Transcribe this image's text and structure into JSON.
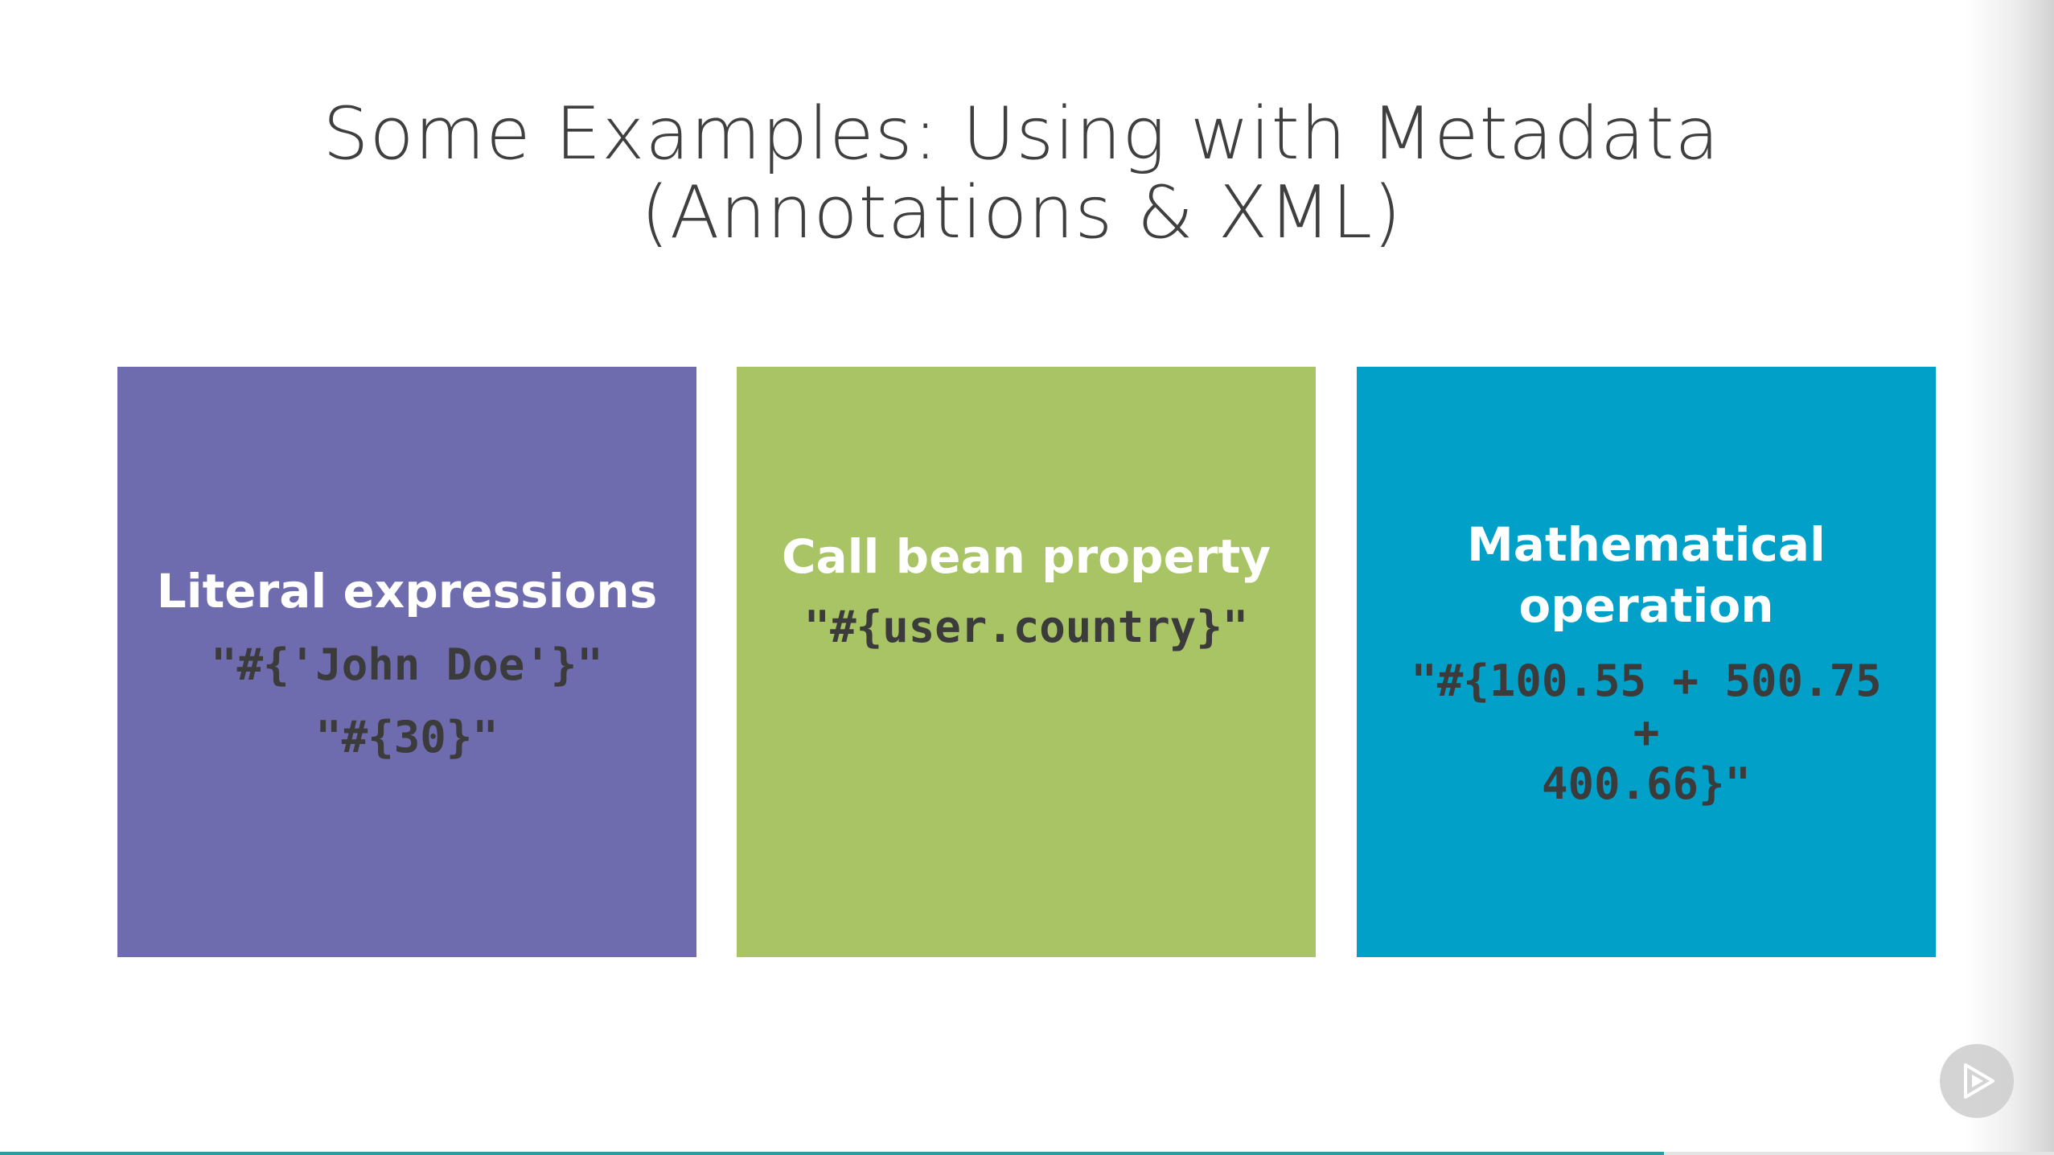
{
  "slide": {
    "title_line1": "Some Examples: Using with Metadata",
    "title_line2": "(Annotations & XML)"
  },
  "cards": [
    {
      "title": "Literal expressions",
      "code": [
        "\"#{'John Doe'}\"",
        "\"#{30}\""
      ],
      "color": "#6e6bae"
    },
    {
      "title": "Call bean property",
      "code": [
        "\"#{user.country}\""
      ],
      "color": "#a8c464"
    },
    {
      "title_line1": "Mathematical",
      "title_line2": "operation",
      "code_line1": "\"#{100.55 + 500.75 +",
      "code_line2": "400.66}\"",
      "color": "#00a0c8"
    }
  ],
  "player": {
    "play_icon": "play-icon",
    "progress": 0.81,
    "progress_color": "#2c9c9c"
  }
}
